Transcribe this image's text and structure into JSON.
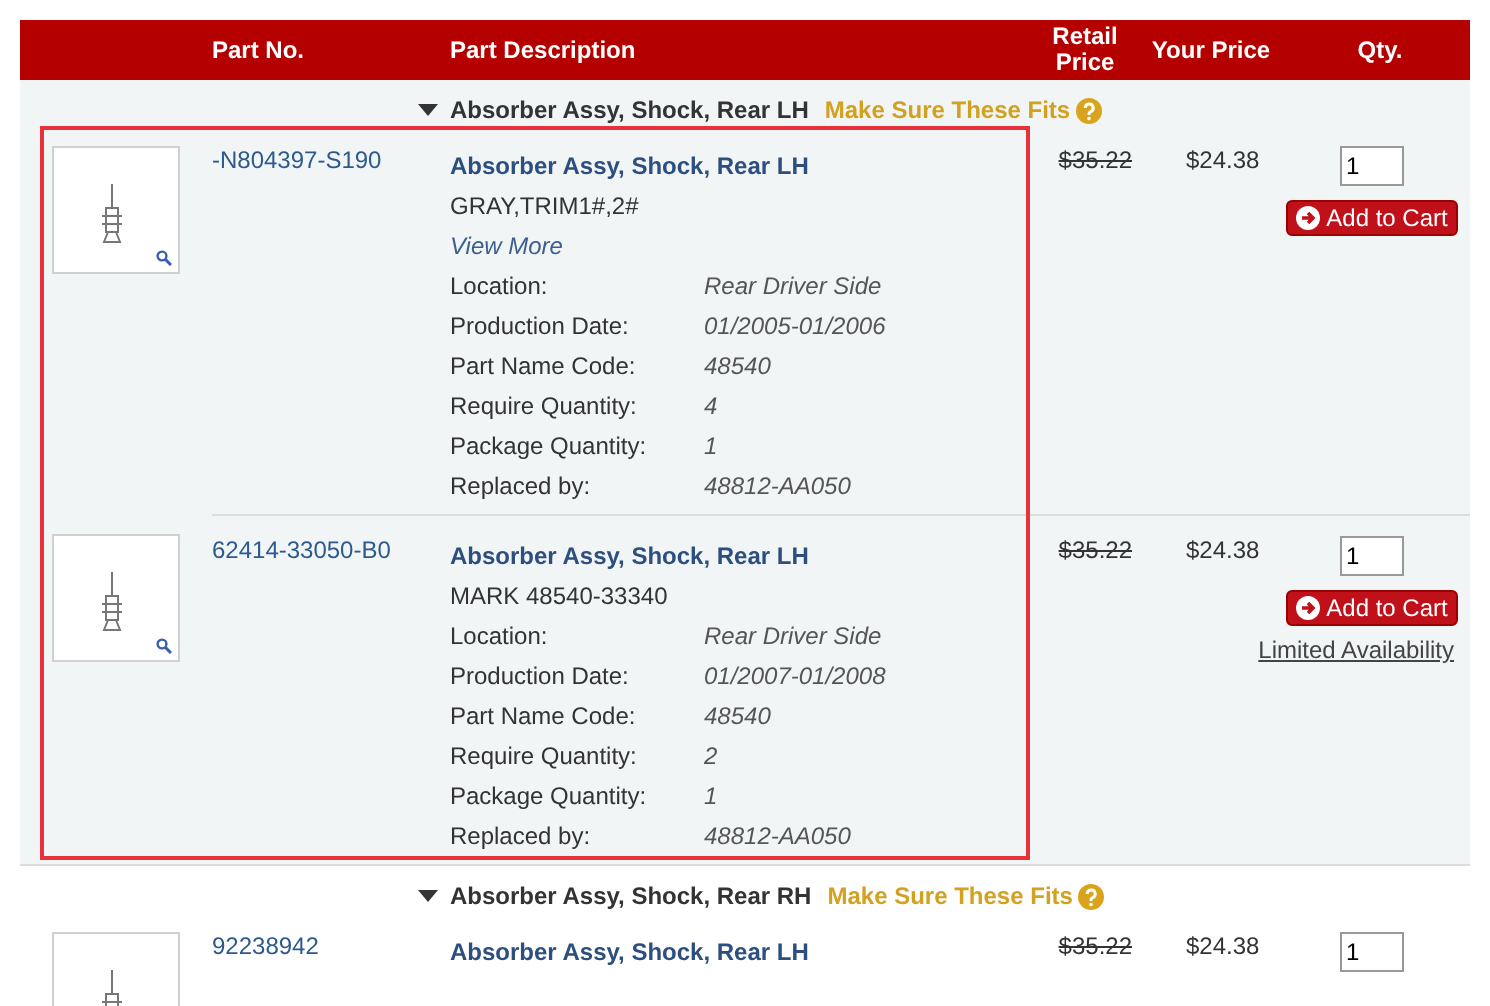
{
  "header": {
    "columns": [
      "Part No.",
      "Part Description",
      "Retail Price",
      "Your Price",
      "Qty."
    ]
  },
  "groups": [
    {
      "title": "Absorber Assy, Shock, Rear LH",
      "fits_label": "Make Sure These Fits",
      "highlighted": true,
      "parts": [
        {
          "part_no": "-N804397-S190",
          "name": "Absorber Assy, Shock, Rear LH",
          "note": "GRAY,TRIM1#,2#",
          "view_more": "View More",
          "specs": [
            {
              "label": "Location:",
              "value": "Rear Driver Side"
            },
            {
              "label": "Production Date:",
              "value": "01/2005-01/2006"
            },
            {
              "label": "Part Name Code:",
              "value": "48540"
            },
            {
              "label": "Require Quantity:",
              "value": "4"
            },
            {
              "label": "Package Quantity:",
              "value": "1"
            },
            {
              "label": "Replaced by:",
              "value": "48812-AA050"
            }
          ],
          "retail": "$35.22",
          "price": "$24.38",
          "qty": "1",
          "add_label": "Add to Cart"
        },
        {
          "part_no": "62414-33050-B0",
          "name": "Absorber Assy, Shock, Rear LH",
          "note": "MARK 48540-33340",
          "specs": [
            {
              "label": "Location:",
              "value": "Rear Driver Side"
            },
            {
              "label": "Production Date:",
              "value": "01/2007-01/2008"
            },
            {
              "label": "Part Name Code:",
              "value": "48540"
            },
            {
              "label": "Require Quantity:",
              "value": "2"
            },
            {
              "label": "Package Quantity:",
              "value": "1"
            },
            {
              "label": "Replaced by:",
              "value": "48812-AA050"
            }
          ],
          "retail": "$35.22",
          "price": "$24.38",
          "qty": "1",
          "add_label": "Add to Cart",
          "availability": "Limited Availability"
        }
      ]
    },
    {
      "title": "Absorber Assy, Shock, Rear RH",
      "fits_label": "Make Sure These Fits",
      "highlighted": false,
      "parts": [
        {
          "part_no": "92238942",
          "name": "Absorber Assy, Shock, Rear LH",
          "retail": "$35.22",
          "price": "$24.38",
          "qty": "1"
        }
      ]
    }
  ]
}
